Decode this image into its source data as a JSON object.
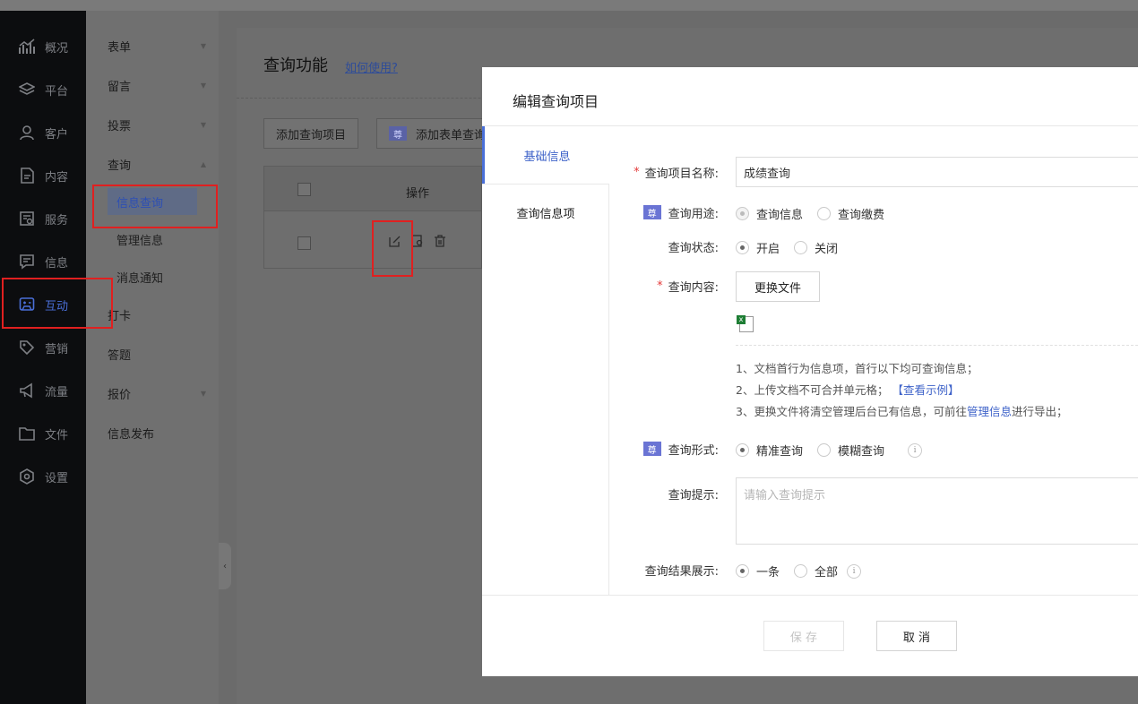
{
  "rail": {
    "items": [
      {
        "label": "概况",
        "icon": "chart-icon"
      },
      {
        "label": "平台",
        "icon": "layers-icon"
      },
      {
        "label": "客户",
        "icon": "user-icon"
      },
      {
        "label": "内容",
        "icon": "document-icon"
      },
      {
        "label": "服务",
        "icon": "service-icon"
      },
      {
        "label": "信息",
        "icon": "message-icon"
      },
      {
        "label": "互动",
        "icon": "interaction-icon"
      },
      {
        "label": "营销",
        "icon": "tag-icon"
      },
      {
        "label": "流量",
        "icon": "megaphone-icon"
      },
      {
        "label": "文件",
        "icon": "folder-icon"
      },
      {
        "label": "设置",
        "icon": "settings-icon"
      }
    ],
    "active": "互动"
  },
  "sub": {
    "items": [
      {
        "label": "表单"
      },
      {
        "label": "留言"
      },
      {
        "label": "投票"
      },
      {
        "label": "查询"
      }
    ],
    "children": [
      {
        "label": "信息查询"
      },
      {
        "label": "管理信息"
      },
      {
        "label": "消息通知"
      }
    ],
    "items_after": [
      {
        "label": "打卡"
      },
      {
        "label": "答题"
      },
      {
        "label": "报价"
      },
      {
        "label": "信息发布"
      }
    ]
  },
  "main": {
    "title": "查询功能",
    "help_link": "如何使用?",
    "add_button": "添加查询项目",
    "add_form_button": "添加表单查询",
    "badge": "尊",
    "table_header_op": "操作"
  },
  "modal": {
    "title": "编辑查询项目",
    "tabs": [
      "基础信息",
      "查询信息项"
    ],
    "fields": {
      "name_label": "查询项目名称:",
      "name_value": "成绩查询",
      "purpose_label": "查询用途:",
      "purpose_options": [
        "查询信息",
        "查询缴费"
      ],
      "status_label": "查询状态:",
      "status_options": [
        "开启",
        "关闭"
      ],
      "content_label": "查询内容:",
      "replace_file_button": "更换文件",
      "notes": {
        "n1": "1、文档首行为信息项，首行以下均可查询信息；",
        "n2": "2、上传文档不可合并单元格；",
        "n2_link": "【查看示例】",
        "n3_pre": "3、更换文件将清空管理后台已有信息，可前往",
        "n3_link": "管理信息",
        "n3_post": "进行导出；"
      },
      "form_label": "查询形式:",
      "form_options": [
        "精准查询",
        "模糊查询"
      ],
      "hint_label": "查询提示:",
      "hint_placeholder": "请输入查询提示",
      "result_label": "查询结果展示:",
      "result_options": [
        "一条",
        "全部"
      ]
    },
    "save_button": "保 存",
    "cancel_button": "取 消"
  },
  "colors": {
    "accent": "#4a6fd8",
    "highlight": "#e02020",
    "required": "#e43b3b"
  }
}
